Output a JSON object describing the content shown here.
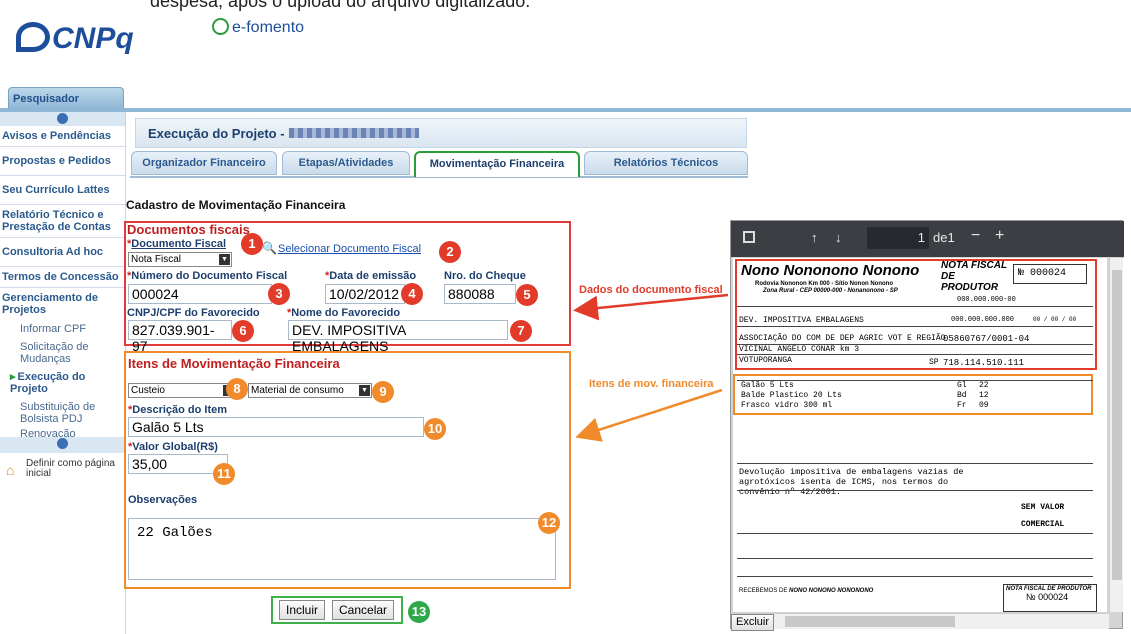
{
  "caption_top": "despesa, após o upload do arquivo digitalizado.",
  "brand": {
    "cnpq": "CNPq",
    "efomento": "e-fomento"
  },
  "top_tab": "Pesquisador",
  "sidebar": {
    "items": [
      "Avisos e Pendências",
      "Propostas e Pedidos",
      "Seu Currículo Lattes",
      "Relatório Técnico e Prestação de Contas",
      "Consultoria Ad hoc",
      "Termos de Concessão",
      "Gerenciamento de Projetos"
    ],
    "subitems": [
      "Informar CPF",
      "Solicitação de Mudanças",
      "Execução do Projeto",
      "Substituição de Bolsista PDJ",
      "Renovação"
    ],
    "home_label": "Definir como página inicial"
  },
  "header": {
    "title": "Execução do Projeto -"
  },
  "tabs": [
    {
      "label": "Organizador Financeiro"
    },
    {
      "label": "Etapas/Atividades"
    },
    {
      "label": "Movimentação Financeira"
    },
    {
      "label": "Relatórios Técnicos"
    }
  ],
  "form": {
    "title": "Cadastro de Movimentação Financeira",
    "docs": {
      "section": "Documentos fiscais",
      "tipo_label": "Documento Fiscal",
      "tipo_value": "Nota Fiscal",
      "select_link": "Selecionar Documento Fiscal",
      "numero_label": "Número do Documento Fiscal",
      "numero_value": "000024",
      "data_label": "Data de emissão",
      "data_value": "10/02/2012",
      "cheque_label": "Nro. do Cheque",
      "cheque_value": "880088",
      "cnpj_label": "CNPJ/CPF do Favorecido",
      "cnpj_value": "827.039.901-97",
      "nome_label": "Nome do Favorecido",
      "nome_value": "DEV. IMPOSITIVA EMBALAGENS"
    },
    "items": {
      "section": "Itens de Movimentação Financeira",
      "categoria": "Custeio",
      "subcategoria": "Material de consumo",
      "descricao_label": "Descrição do Item",
      "descricao_value": "Galão 5 Lts",
      "valor_label": "Valor Global(R$)",
      "valor_value": "35,00",
      "obs_label": "Observações",
      "obs_value": "22 Galões"
    },
    "buttons": {
      "incluir": "Incluir",
      "cancelar": "Cancelar"
    }
  },
  "badges": [
    "1",
    "2",
    "3",
    "4",
    "5",
    "6",
    "7",
    "8",
    "9",
    "10",
    "11",
    "12",
    "13"
  ],
  "annotations": {
    "doc": "Dados do documento fiscal",
    "items": "Itens de mov. financeira"
  },
  "viewer": {
    "page": "1",
    "of": "de1",
    "doc": {
      "company": "Nono Nononono  Nonono",
      "address1": "Rodovia Nononon Km 000 - Sítio Nonon Nonono",
      "address2": "Zona Rural - CEP 00000-000 - Nonanonono - SP",
      "nf_title": "NOTA FISCAL DE PRODUTOR",
      "nf_number": "№ 000024",
      "insc1": "000.000.000-00",
      "insc2": "000.000.000.000",
      "date_blank": "00 / 00 / 00",
      "dest1": "DEV. IMPOSITIVA EMBALAGENS",
      "dest2": "ASSOCIAÇÃO DO COM DE DEP AGRIC VOT E REGIÃO",
      "cnpj": "05860767/0001-04",
      "dest3": "VICINAL ANGELO CONAR km 3",
      "city": "VOTUPORANGA",
      "uf": "SP",
      "ie": "718.114.510.111",
      "items": [
        {
          "desc": "Galão 5 Lts",
          "un": "Gl",
          "qt": "22"
        },
        {
          "desc": "Balde Plastico 20 Lts",
          "un": "Bd",
          "qt": "12"
        },
        {
          "desc": "Frasco vidro 300 ml",
          "un": "Fr",
          "qt": "09"
        }
      ],
      "note": "Devolução impositiva de embalagens vazias de agrotóxicos isenta de ICMS, nos termos do convênio nº 42/2001.",
      "sem_valor": "SEM VALOR",
      "comercial": "COMERCIAL",
      "recebemos_a": "RECEBEMOS DE",
      "recebemos_b": "NONO NONONO NONONONO",
      "footer_nf": "NOTA FISCAL DE PRODUTOR",
      "footer_number": "№ 000024"
    },
    "excluir": "Excluir"
  }
}
